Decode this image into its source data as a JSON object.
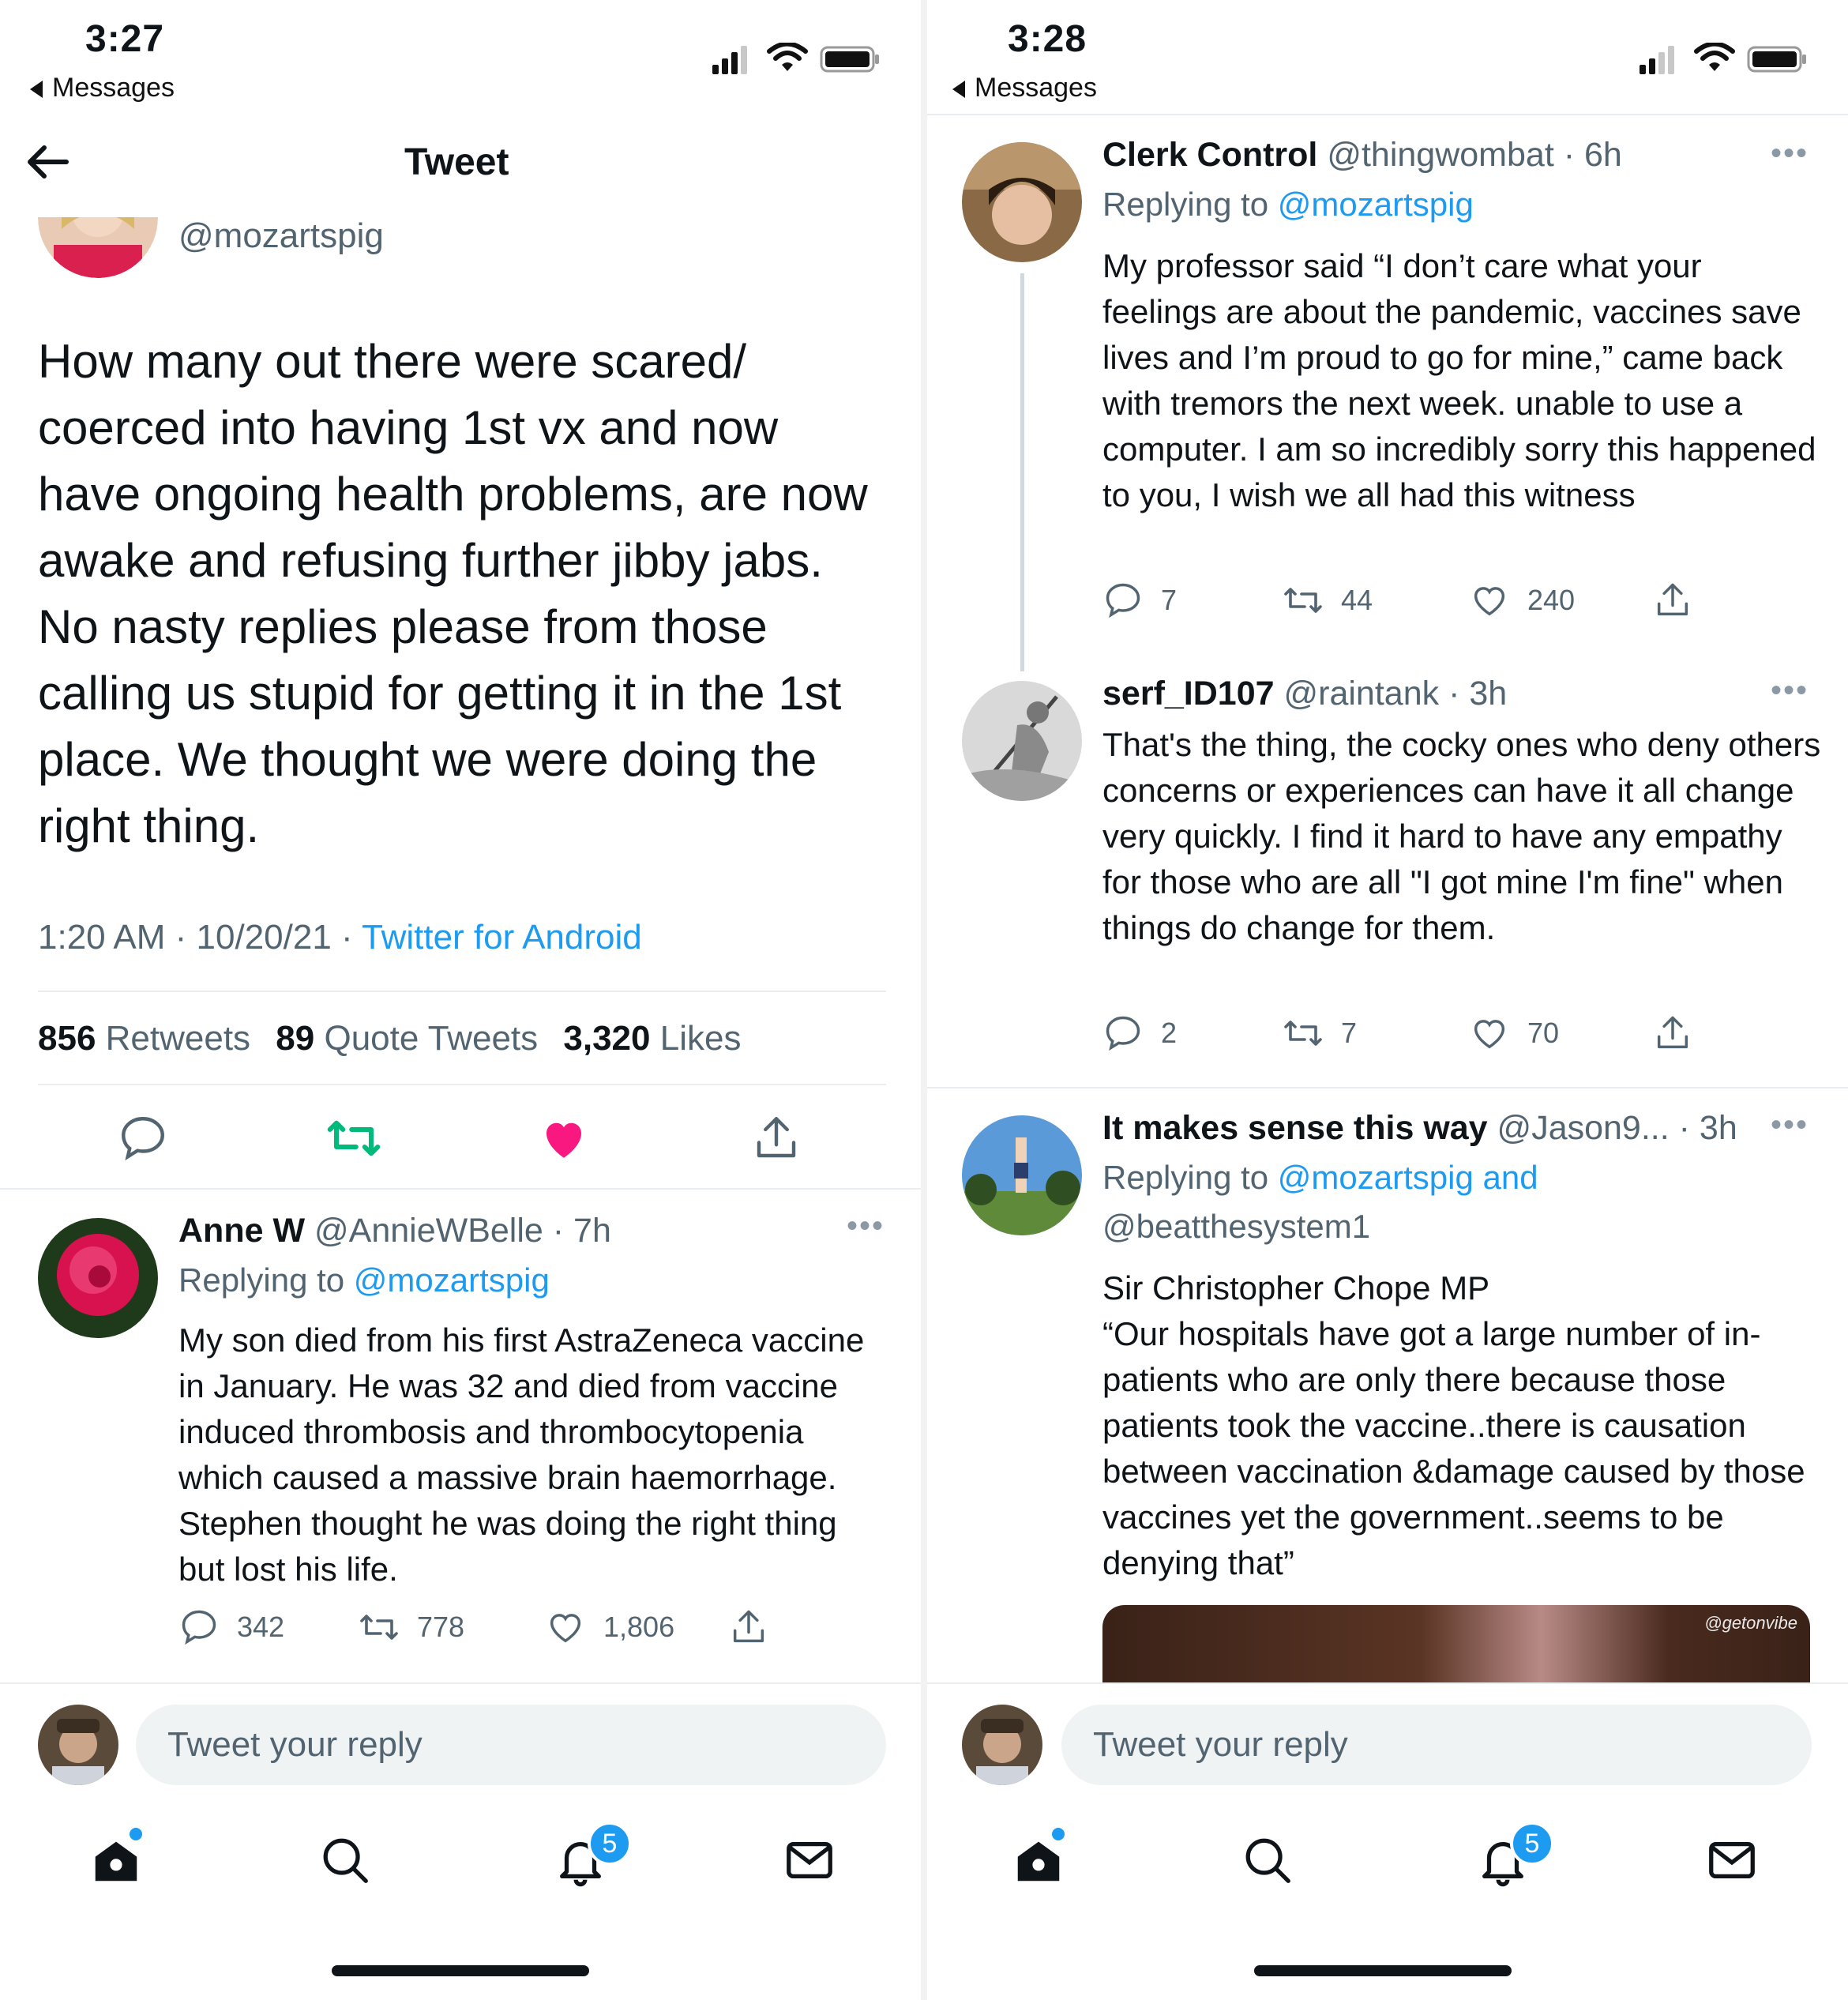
{
  "left": {
    "status_time": "3:27",
    "back_app": "Messages",
    "header_title": "Tweet",
    "author_handle": "@mozartspig",
    "tweet_text": "How many out there were scared/ coerced into having 1st vx and now have ongoing health problems, are now awake and refusing further jibby jabs. No nasty replies please from those calling us stupid for getting it in the 1st place. We thought we were doing the right thing.",
    "tweet_time": "1:20 AM · 10/20/21 · ",
    "tweet_source": "Twitter for Android",
    "stats": {
      "retweets_count": "856",
      "retweets_label": " Retweets",
      "quotes_count": "89",
      "quotes_label": " Quote Tweets",
      "likes_count": "3,320",
      "likes_label": " Likes"
    },
    "reply": {
      "name": "Anne W",
      "handle_time": " @AnnieWBelle · 7h",
      "replying_prefix": "Replying to ",
      "replying_to": "@mozartspig",
      "text": "My son died from his first AstraZeneca vaccine in January. He was 32 and died from vaccine induced thrombosis and thrombocytopenia which caused a massive brain haemorrhage. Stephen thought he was doing the right thing  but lost his life.",
      "replies": "342",
      "retweets": "778",
      "likes": "1,806"
    },
    "reply_placeholder": "Tweet your reply",
    "notif_badge": "5"
  },
  "right": {
    "status_time": "3:28",
    "back_app": "Messages",
    "replies": [
      {
        "name": "Clerk Control",
        "handle_time": " @thingwombat · 6h",
        "replying_prefix": "Replying to ",
        "replying_to": "@mozartspig",
        "text": "My professor said “I don’t care what your feelings are about the pandemic, vaccines save lives and I’m proud to go for mine,” came back with tremors the next week. unable to use a computer. I am so incredibly sorry this happened to you, I wish we all had this witness",
        "replies": "7",
        "retweets": "44",
        "likes": "240"
      },
      {
        "name": "serf_ID107",
        "handle_time": " @raintank · 3h",
        "text": "That's the thing, the cocky ones who deny others concerns or experiences can have it all change very quickly. I find it hard to have any empathy for those who are all \"I got mine I'm fine\" when things do change for them.",
        "replies": "2",
        "retweets": "7",
        "likes": "70"
      },
      {
        "name": "It makes sense this way",
        "handle": " @Jason9...",
        "time": " · 3h",
        "replying_prefix": "Replying to ",
        "replying_to": "@mozartspig and",
        "replying_to_2": "@beatthesystem1",
        "text": "Sir Christopher Chope MP\n“Our hospitals have got a large number of in-patients who are only there because those patients took the vaccine..there is causation between vaccination &damage caused by those vaccines yet the government..seems to be denying that”",
        "media_watermark": "@getonvibe"
      }
    ],
    "reply_placeholder": "Tweet your reply",
    "notif_badge": "5"
  },
  "colors": {
    "accent": "#1d9bf0",
    "like": "#f91880",
    "retweet": "#00ba7c",
    "text": "#0f1419",
    "muted": "#536471"
  }
}
